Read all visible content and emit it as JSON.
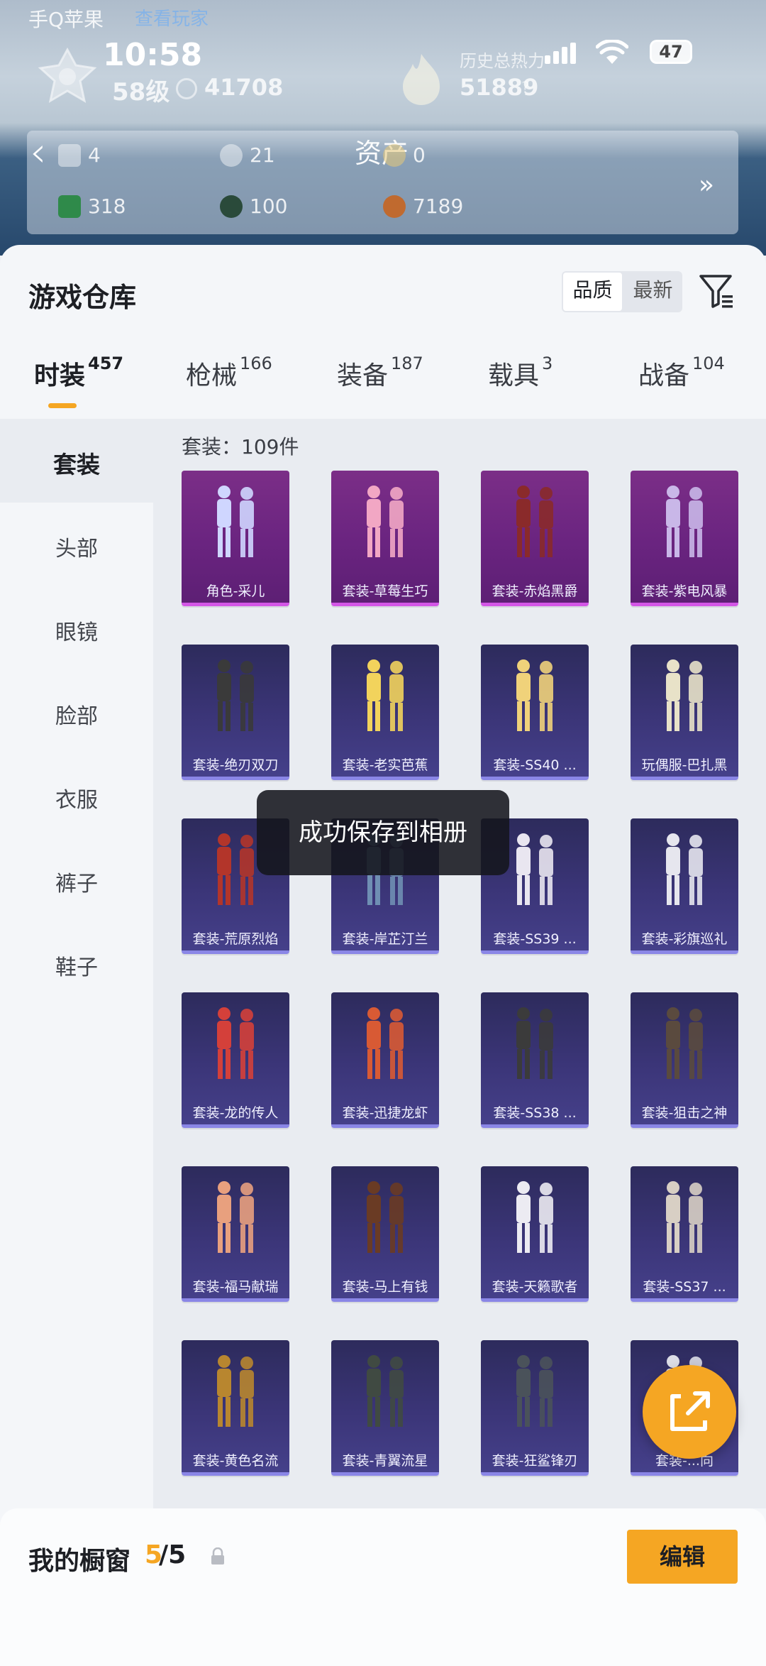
{
  "status": {
    "time": "10:58",
    "battery": "47",
    "top_left": "手Q苹果",
    "top_left_link": "查看玩家"
  },
  "profile": {
    "level": "58级",
    "points": "41708",
    "history_label": "历史总热力",
    "history_value": "51889",
    "history_hint": "?"
  },
  "assets": {
    "title": "资产",
    "row1": [
      {
        "icon": "card-icon",
        "value": "4"
      },
      {
        "icon": "coin-silver-icon",
        "value": "21"
      },
      {
        "icon": "coin-gold-icon",
        "value": "0"
      }
    ],
    "row2": [
      {
        "icon": "ticket-icon",
        "value": "318"
      },
      {
        "icon": "orb-icon",
        "value": "100"
      },
      {
        "icon": "copper-coin-icon",
        "value": "7189"
      }
    ]
  },
  "warehouse": {
    "title": "游戏仓库",
    "sort_quality": "品质",
    "sort_newest": "最新"
  },
  "tabs": [
    {
      "label": "时装",
      "count": "457"
    },
    {
      "label": "枪械",
      "count": "166"
    },
    {
      "label": "装备",
      "count": "187"
    },
    {
      "label": "载具",
      "count": "3"
    },
    {
      "label": "战备",
      "count": "104"
    }
  ],
  "sidebar": [
    "套装",
    "头部",
    "眼镜",
    "脸部",
    "衣服",
    "裤子",
    "鞋子"
  ],
  "count_text": "套装：109件",
  "items": [
    {
      "name": "角色-采儿",
      "tier": "purple",
      "color": "#cfd6ff"
    },
    {
      "name": "套装-草莓生巧",
      "tier": "purple",
      "color": "#f2a7c4"
    },
    {
      "name": "套装-赤焰黑爵",
      "tier": "purple",
      "color": "#8a2a2a"
    },
    {
      "name": "套装-紫电风暴",
      "tier": "purple",
      "color": "#c9b7e8"
    },
    {
      "name": "套装-绝刃双刀",
      "tier": "blue",
      "color": "#3a3a3a"
    },
    {
      "name": "套装-老实芭蕉",
      "tier": "blue",
      "color": "#f2d35c"
    },
    {
      "name": "套装-SS40 ...",
      "tier": "blue",
      "color": "#f0d27a"
    },
    {
      "name": "玩偶服-巴扎黑",
      "tier": "blue",
      "color": "#e8e2c8"
    },
    {
      "name": "套装-荒原烈焰",
      "tier": "blue",
      "color": "#b3352a"
    },
    {
      "name": "套装-岸芷汀兰",
      "tier": "blue",
      "color": "#6f8fb3"
    },
    {
      "name": "套装-SS39 ...",
      "tier": "blue",
      "color": "#e9e6f0"
    },
    {
      "name": "套装-彩旗巡礼",
      "tier": "blue",
      "color": "#e6e6ee"
    },
    {
      "name": "套装-龙的传人",
      "tier": "blue",
      "color": "#d4403a"
    },
    {
      "name": "套装-迅捷龙虾",
      "tier": "blue",
      "color": "#d85a34"
    },
    {
      "name": "套装-SS38 ...",
      "tier": "blue",
      "color": "#3b3b3b"
    },
    {
      "name": "套装-狙击之神",
      "tier": "blue",
      "color": "#5a4a3e"
    },
    {
      "name": "套装-福马献瑞",
      "tier": "blue",
      "color": "#e8a07e"
    },
    {
      "name": "套装-马上有钱",
      "tier": "blue",
      "color": "#6a3b24"
    },
    {
      "name": "套装-天籁歌者",
      "tier": "blue",
      "color": "#ecebf2"
    },
    {
      "name": "套装-SS37 ...",
      "tier": "blue",
      "color": "#d8cfc4"
    },
    {
      "name": "套装-黄色名流",
      "tier": "blue",
      "color": "#b8862f"
    },
    {
      "name": "套装-青翼流星",
      "tier": "blue",
      "color": "#404a42"
    },
    {
      "name": "套装-狂鲨锋刃",
      "tier": "blue",
      "color": "#4a525a"
    },
    {
      "name": "套装-...向",
      "tier": "blue",
      "color": "#dcdde6"
    }
  ],
  "toast": "成功保存到相册",
  "bottom": {
    "label": "我的橱窗",
    "current": "5",
    "total": "/5",
    "edit": "编辑"
  },
  "colors": {
    "accent": "#f5a623",
    "purple_tier": "#d356e6",
    "blue_tier": "#8a86e6"
  }
}
